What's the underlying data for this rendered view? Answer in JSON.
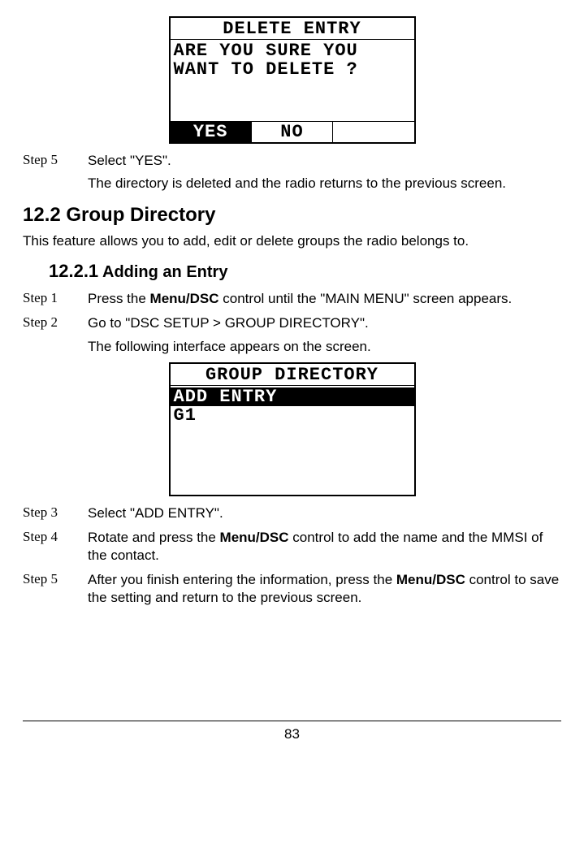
{
  "lcd1": {
    "title": "DELETE ENTRY",
    "line1": "ARE YOU SURE YOU",
    "line2": "WANT TO DELETE ?",
    "soft1": "YES",
    "soft2": "NO",
    "soft3": ""
  },
  "block1": {
    "step5": {
      "label": "Step 5",
      "text1a": "Select \"YES\".",
      "text1b": "The directory is deleted and the radio returns to the previous screen."
    }
  },
  "section12_2": {
    "heading": "12.2 Group Directory",
    "desc": "This feature allows you to add, edit or delete groups the radio belongs to."
  },
  "sub12_2_1": {
    "num": "12.2.1",
    "title": "Adding an Entry"
  },
  "steps2": {
    "s1": {
      "label": "Step 1",
      "pre": "Press the ",
      "bold": "Menu/DSC",
      "post": " control until the \"MAIN MENU\" screen appears."
    },
    "s2": {
      "label": "Step 2",
      "line1": "Go to \"DSC SETUP > GROUP DIRECTORY\".",
      "line2": "The following interface appears on the screen."
    },
    "s3": {
      "label": "Step 3",
      "text": "Select \"ADD ENTRY\"."
    },
    "s4": {
      "label": "Step 4",
      "pre": "Rotate and press the ",
      "bold": "Menu/DSC",
      "post": " control to add the name and the MMSI of the contact."
    },
    "s5": {
      "label": "Step 5",
      "pre": "After you finish entering the information, press the ",
      "bold": "Menu/DSC",
      "post": " control to save the setting and return to the previous screen."
    }
  },
  "lcd2": {
    "title": "GROUP DIRECTORY",
    "line1": "ADD ENTRY",
    "line2": "G1"
  },
  "page_number": "83"
}
